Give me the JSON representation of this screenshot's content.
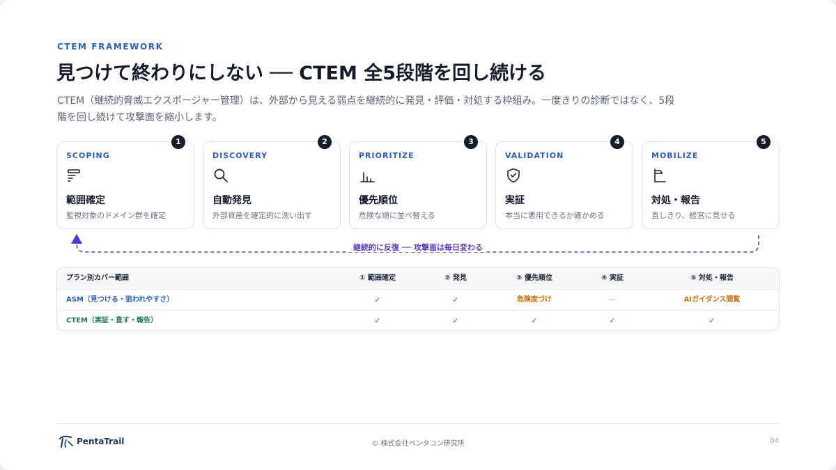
{
  "header": {
    "eyebrow": "CTEM FRAMEWORK",
    "title": "見つけて終わりにしない ── CTEM 全5段階を回し続ける",
    "lead": "CTEM（継続的脅威エクスポージャー管理）は、外部から見える弱点を継続的に発見・評価・対処する枠組み。一度きりの診断ではなく、5段階を回し続けて攻撃面を縮小します。"
  },
  "steps": [
    {
      "num": "1",
      "en": "SCOPING",
      "ja": "範囲確定",
      "desc": "監視対象のドメイン群を確定",
      "icon": "list-icon"
    },
    {
      "num": "2",
      "en": "DISCOVERY",
      "ja": "自動発見",
      "desc": "外部資産を確定的に洗い出す",
      "icon": "search-icon"
    },
    {
      "num": "3",
      "en": "PRIORITIZE",
      "ja": "優先順位",
      "desc": "危険な順に並べ替える",
      "icon": "bar-chart-icon"
    },
    {
      "num": "4",
      "en": "VALIDATION",
      "ja": "実証",
      "desc": "本当に悪用できるか確かめる",
      "icon": "shield-check-icon"
    },
    {
      "num": "5",
      "en": "MOBILIZE",
      "ja": "対処・報告",
      "desc": "直しきり、経営に見せる",
      "icon": "flag-icon"
    }
  ],
  "loop": {
    "label": "継続的に反復 ── 攻撃面は毎日変わる"
  },
  "table": {
    "headers": [
      "プラン別カバー範囲",
      "① 範囲確定",
      "② 発見",
      "③ 優先順位",
      "④ 実証",
      "⑤ 対処・報告"
    ],
    "rows": [
      {
        "name": "ASM（見つける・狙われやすさ）",
        "cells": [
          "✓",
          "✓",
          "危険度づけ",
          "—",
          "AIガイダンス閲覧"
        ]
      },
      {
        "name": "CTEM（実証・直す・報告）",
        "cells": [
          "✓",
          "✓",
          "✓",
          "✓",
          "✓"
        ]
      }
    ]
  },
  "footer": {
    "logo_text": "PentaTrail",
    "copyright": "© 株式会社ペンタコン研究所",
    "page": "04"
  },
  "colors": {
    "accent": "#2f5fb3",
    "loop": "#5b3fc4",
    "ctem": "#1d7a4e",
    "orange": "#c7700f"
  }
}
